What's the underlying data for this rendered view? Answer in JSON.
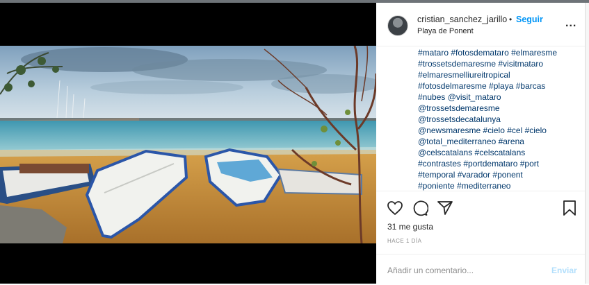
{
  "post": {
    "username": "cristian_sanchez_jarillo",
    "separator": "•",
    "follow_label": "Seguir",
    "location": "Playa de Ponent",
    "more_label": "...",
    "caption_lines": [
      "#mataro #fotosdemataro #elmaresme",
      "#trossetsdemaresme #visitmataro",
      "#elmaresmelliureitropical",
      "#fotosdelmaresme #playa #barcas",
      "#nubes @visit_mataro",
      "@trossetsdemaresme",
      "@trossetsdecatalunya",
      "@newsmaresme #cielo #cel #cielo",
      "@total_mediterraneo #arena",
      "@celscatalans #celscatalans",
      "#contrastes #portdemataro #port",
      "#temporal #varador #ponent",
      "#poniente #mediterraneo"
    ],
    "likes": "31 me gusta",
    "time": "HACE 1 DÍA",
    "comment_placeholder": "Añadir un comentario...",
    "post_label": "Enviar"
  },
  "photo": {
    "description_icons": [
      "heart-icon",
      "comment-icon",
      "share-icon",
      "bookmark-icon"
    ]
  }
}
